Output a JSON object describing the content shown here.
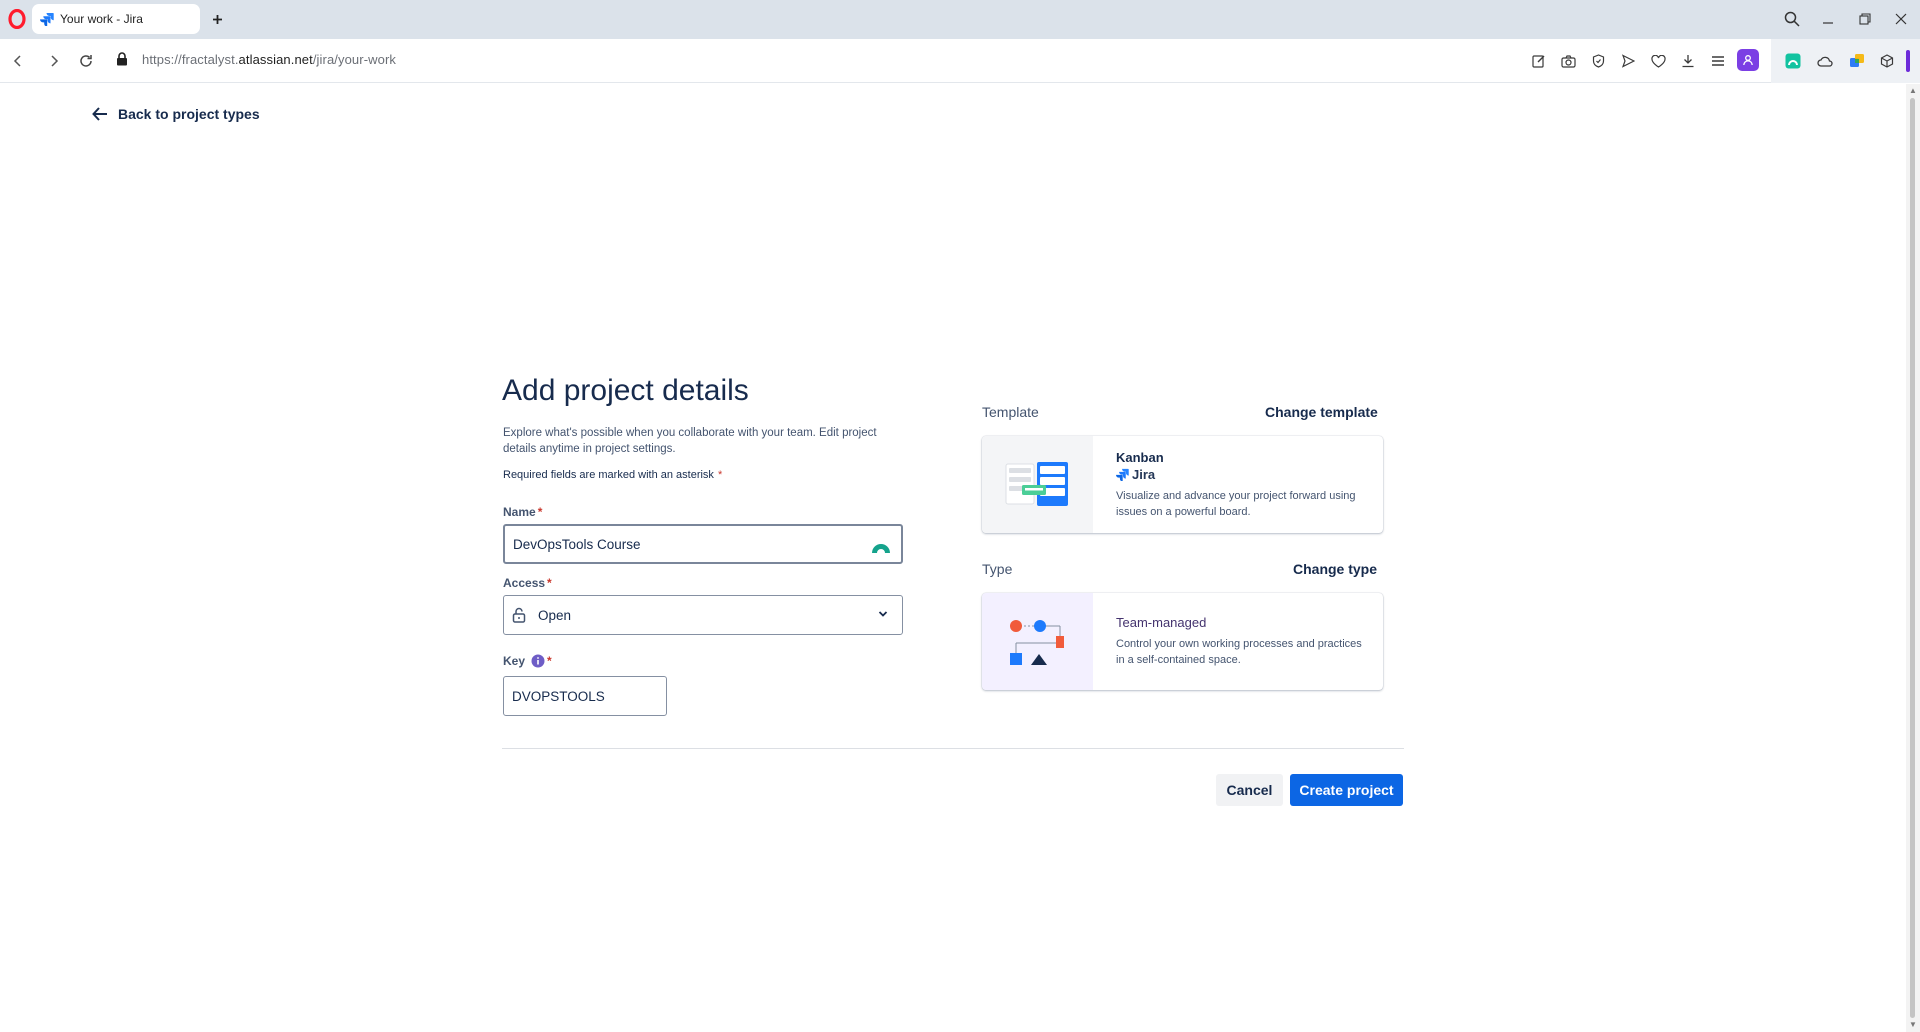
{
  "browser": {
    "tab_title": "Your work - Jira",
    "url_prefix": "https://fractalyst.",
    "url_host": "atlassian.net",
    "url_path": "/jira/your-work"
  },
  "page": {
    "back_link": "Back to project types",
    "title": "Add project details",
    "intro": "Explore what's possible when you collaborate with your team. Edit project details anytime in project settings.",
    "required_note": "Required fields are marked with an asterisk",
    "asterisk": "*"
  },
  "form": {
    "name_label": "Name",
    "name_value": "DevOpsTools Course",
    "access_label": "Access",
    "access_value": "Open",
    "key_label": "Key",
    "key_value": "DVOPSTOOLS"
  },
  "template_section": {
    "label": "Template",
    "change_link": "Change template",
    "card_title": "Kanban",
    "card_product": "Jira",
    "card_desc": "Visualize and advance your project forward using issues on a powerful board."
  },
  "type_section": {
    "label": "Type",
    "change_link": "Change type",
    "card_title": "Team-managed",
    "card_desc": "Control your own working processes and practices in a self-contained space."
  },
  "actions": {
    "cancel": "Cancel",
    "create": "Create project"
  },
  "colors": {
    "primary": "#0C66E4",
    "text": "#172B4D",
    "required": "#C9372C",
    "opera_red": "#FF1B2D",
    "profile_purple": "#7B3FE4"
  }
}
